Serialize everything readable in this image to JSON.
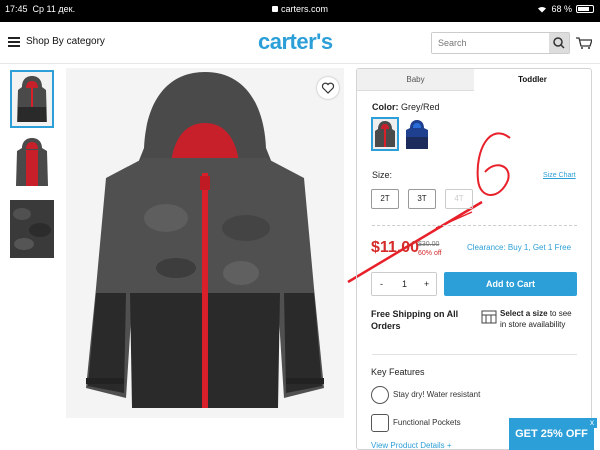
{
  "status_bar": {
    "time": "17:45",
    "date": "Ср 11 дек.",
    "url": "carters.com",
    "battery": "68 %",
    "battery_level": 0.68
  },
  "header": {
    "menu_label": "Shop By category",
    "logo": "carter's",
    "search_placeholder": "Search"
  },
  "product_images": {
    "thumbnail_count": 3,
    "selected_thumbnail": 1
  },
  "panel": {
    "tabs": [
      {
        "label": "Baby",
        "active": false
      },
      {
        "label": "Toddler",
        "active": true
      }
    ],
    "color_label": "Color:",
    "color_value": "Grey/Red",
    "size_label": "Size:",
    "size_chart": "Size Chart",
    "sizes": [
      "2T",
      "3T",
      "4T"
    ],
    "price": "$11.00",
    "was_price": "$30.00",
    "discount": "60% off",
    "promo": "Clearance: Buy 1, Get 1 Free",
    "quantity": "1",
    "qty_minus": "-",
    "qty_plus": "+",
    "add_to_cart": "Add to Cart",
    "free_shipping": "Free Shipping on All Orders",
    "store_text_bold": "Select a size",
    "store_text": " to see in store availability",
    "key_features": "Key Features",
    "features": [
      "Stay dry! Water resistant",
      "Functional Pockets"
    ],
    "view_details": "View Product Details +"
  },
  "annotation": {
    "handwritten_number": "6"
  },
  "promo_banner": {
    "label": "GET 25% OFF",
    "close": "x"
  },
  "colors": {
    "brand_blue": "#2c9fd8",
    "sale_red": "#d52b2b",
    "annotation_red": "#e8202a"
  }
}
